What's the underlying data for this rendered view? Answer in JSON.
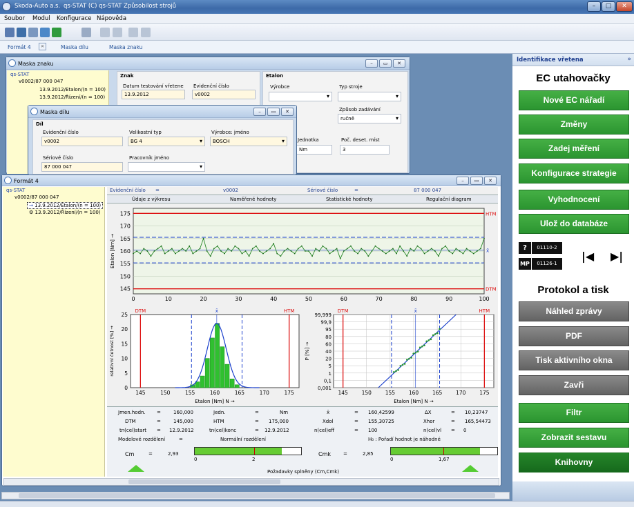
{
  "window": {
    "app_name": "Skoda-Auto a.s.",
    "title": "qs-STAT (C) qs-STAT Způsobilost strojů"
  },
  "menu": [
    "Soubor",
    "Modul",
    "Konfigurace",
    "Nápověda"
  ],
  "tabs": [
    "Formát 4",
    "Maska dílu",
    "Maska znaku"
  ],
  "maska_znaku": {
    "title": "Maska znaku",
    "tree": [
      "qs-STAT",
      "v0002/87 000 047",
      "13.9.2012/Etalon/(n = 100)",
      "13.9.2012/Řízení/(n = 100)"
    ],
    "znak_group": "Znak",
    "datum_label": "Datum testování vřetene",
    "datum_value": "13.9.2012",
    "evid_label": "Evidenční číslo",
    "evid_value": "v0002",
    "etalon_group": "Etalon",
    "vyrobce_label": "Výrobce",
    "typ_stroje_label": "Typ stroje",
    "zpusob_label": "Způsob zadávání",
    "zpusob_value": "ručně",
    "jednotka_label": "Jednotka",
    "jednotka_value": "Nm",
    "pocet_label": "Poč. deset. míst",
    "pocet_value": "3"
  },
  "maska_dilu": {
    "title": "Maska dílu",
    "group": "Díl",
    "evid_label": "Evidenční číslo",
    "evid_value": "v0002",
    "vel_label": "Velikostní typ",
    "vel_value": "BG 4",
    "vyr_label": "Výrobce: jméno",
    "vyr_value": "BOSCH",
    "serial_label": "Sériové číslo",
    "serial_value": "87 000 047",
    "prac_label": "Pracovník jméno",
    "prac_value": ""
  },
  "format4": {
    "title": "Formát 4",
    "tree": [
      "qs-STAT",
      "v0002/87 000 047",
      "13.9.2012/Etalon/(n = 100)",
      "13.9.2012/Řízení/(n = 100)"
    ],
    "header": {
      "evid_label": "Evidenční číslo",
      "eq": "=",
      "evid_value": "v0002",
      "serial_label": "Sériové číslo",
      "serial_value": "87 000 047"
    },
    "subtabs": [
      "Údaje z výkresu",
      "Naměřené hodnoty",
      "Statistické hodnoty",
      "Regulační diagram"
    ],
    "stats": {
      "jmen_label": "Jmen.hodn.",
      "jmen": "160,000",
      "jedn_label": "Jedn.",
      "jedn": "Nm",
      "xbar_sym": "x̄",
      "xbar": "160,42599",
      "dx_label": "ΔX",
      "dx": "10,23747",
      "dtm_label": "DTM",
      "dtm": "145,000",
      "htm_label": "HTM",
      "htm": "175,000",
      "xdol_label": "Xdol",
      "xdol": "155,30725",
      "xhor_label": "Xhor",
      "xhor": "165,54473",
      "tstart_label": "tn(cel)start",
      "tstart": "12.9.2012",
      "tkon_label": "tn(cel)konc",
      "tkon": "12.9.2012",
      "neff_label": "n(cel)eff",
      "neff": "100",
      "nvl_label": "n(cel)vl",
      "nvl": "0",
      "model_label": "Modelové rozdělení",
      "eq": "=",
      "model_value": "Normální rozdělení",
      "h0": "H₀ : Pořadí hodnot je náhodné",
      "cm_label": "Cm",
      "cm": "2,93",
      "cmk_label": "Cmk",
      "cmk": "2,85",
      "cm_scale_0": "0",
      "cm_scale_2": "2",
      "cmk_scale_0": "0",
      "cmk_scale_167": "1,67",
      "pozad": "Požadavky splněny (Cm,Cmk)"
    }
  },
  "chart_data": [
    {
      "type": "line",
      "title": "",
      "ylabel": "Etalon [Nm] →",
      "xlabel": "",
      "x_range": [
        0,
        100
      ],
      "y_range": [
        143,
        177
      ],
      "x_ticks": [
        "0",
        "10",
        "20",
        "30",
        "40",
        "50",
        "60",
        "70",
        "80",
        "90",
        "100"
      ],
      "y_ticks": [
        "145",
        "150",
        "155",
        "160",
        "165",
        "170",
        "175"
      ],
      "limits": {
        "HTM": 175,
        "DTM": 145,
        "upper_dashed": 165.5,
        "lower_dashed": 155.3,
        "mean": 160.4
      },
      "limit_labels": {
        "HTM": "HTM",
        "DTM": "DTM",
        "mean": "x̄"
      },
      "series": [
        {
          "values": [
            159,
            160,
            159,
            161,
            160,
            158,
            160,
            161,
            162,
            159,
            160,
            161,
            159,
            160,
            161,
            160,
            162,
            159,
            160,
            161,
            165,
            160,
            158,
            161,
            162,
            160,
            159,
            161,
            160,
            162,
            161,
            159,
            160,
            158,
            161,
            162,
            160,
            159,
            160,
            161,
            163,
            159,
            158,
            160,
            161,
            160,
            159,
            161,
            162,
            160,
            160,
            158,
            161,
            160,
            162,
            161,
            159,
            160,
            161,
            157,
            160,
            161,
            162,
            160,
            159,
            161,
            160,
            158,
            160,
            162,
            161,
            160,
            159,
            160,
            161,
            159,
            162,
            160,
            158,
            161,
            160,
            162,
            161,
            159,
            160,
            161,
            160,
            158,
            161,
            162,
            160,
            159,
            161,
            160,
            159,
            161,
            160,
            159,
            160,
            161,
            165
          ]
        }
      ]
    },
    {
      "type": "bar",
      "title": "",
      "ylabel": "relativní četnost [%] →",
      "xlabel": "Etalon [Nm] N →",
      "x_range": [
        143,
        177
      ],
      "y_range": [
        0,
        25
      ],
      "x_ticks": [
        "145",
        "150",
        "155",
        "160",
        "165",
        "170",
        "175"
      ],
      "y_ticks": [
        "0",
        "5",
        "10",
        "15",
        "20",
        "25"
      ],
      "limit_labels": {
        "DTM": "DTM",
        "mean": "x̄",
        "HTM": "HTM"
      },
      "bins": [
        155.5,
        156.5,
        157.5,
        158.5,
        159.5,
        160.5,
        161.5,
        162.5,
        163.5,
        164.5
      ],
      "values": [
        1,
        2,
        4,
        10,
        17,
        22,
        14,
        8,
        3,
        1
      ]
    },
    {
      "type": "scatter",
      "title": "",
      "ylabel": "P [%] →",
      "xlabel": "Etalon [Nm] N →",
      "x_range": [
        143,
        177
      ],
      "x_ticks": [
        "145",
        "150",
        "155",
        "160",
        "165",
        "170",
        "175"
      ],
      "y_ticks": [
        "0,001",
        "0,1",
        "1",
        "5",
        "20",
        "40",
        "60",
        "80",
        "95",
        "99,9",
        "99,999"
      ],
      "limit_labels": {
        "DTM": "DTM",
        "mean": "x̄",
        "HTM": "HTM"
      }
    }
  ],
  "right_panel": {
    "header": "Identifikace vřetena",
    "title1": "EC utahovačky",
    "buttons1": [
      "Nové EC nářadí",
      "Změny",
      "Zadej měření",
      "Konfigurace strategie",
      "Vyhodnocení",
      "Ulož do databáze"
    ],
    "q": "?",
    "mp": "MP",
    "id1": "01110-2",
    "id2": "01126-1",
    "title2": "Protokol a tisk",
    "buttons2": [
      "Náhled zprávy",
      "PDF",
      "Tisk aktivního okna",
      "Zavři"
    ],
    "buttons3": [
      "Filtr",
      "Zobrazit sestavu",
      "Knihovny"
    ]
  },
  "colors": {
    "green": "#2b9530",
    "dark_green": "#1a7a21",
    "gray_button": "#6e6e6e",
    "limit_red": "#d11",
    "mean_blue": "#1a3fcc",
    "tree_bg": "#fefccf"
  }
}
